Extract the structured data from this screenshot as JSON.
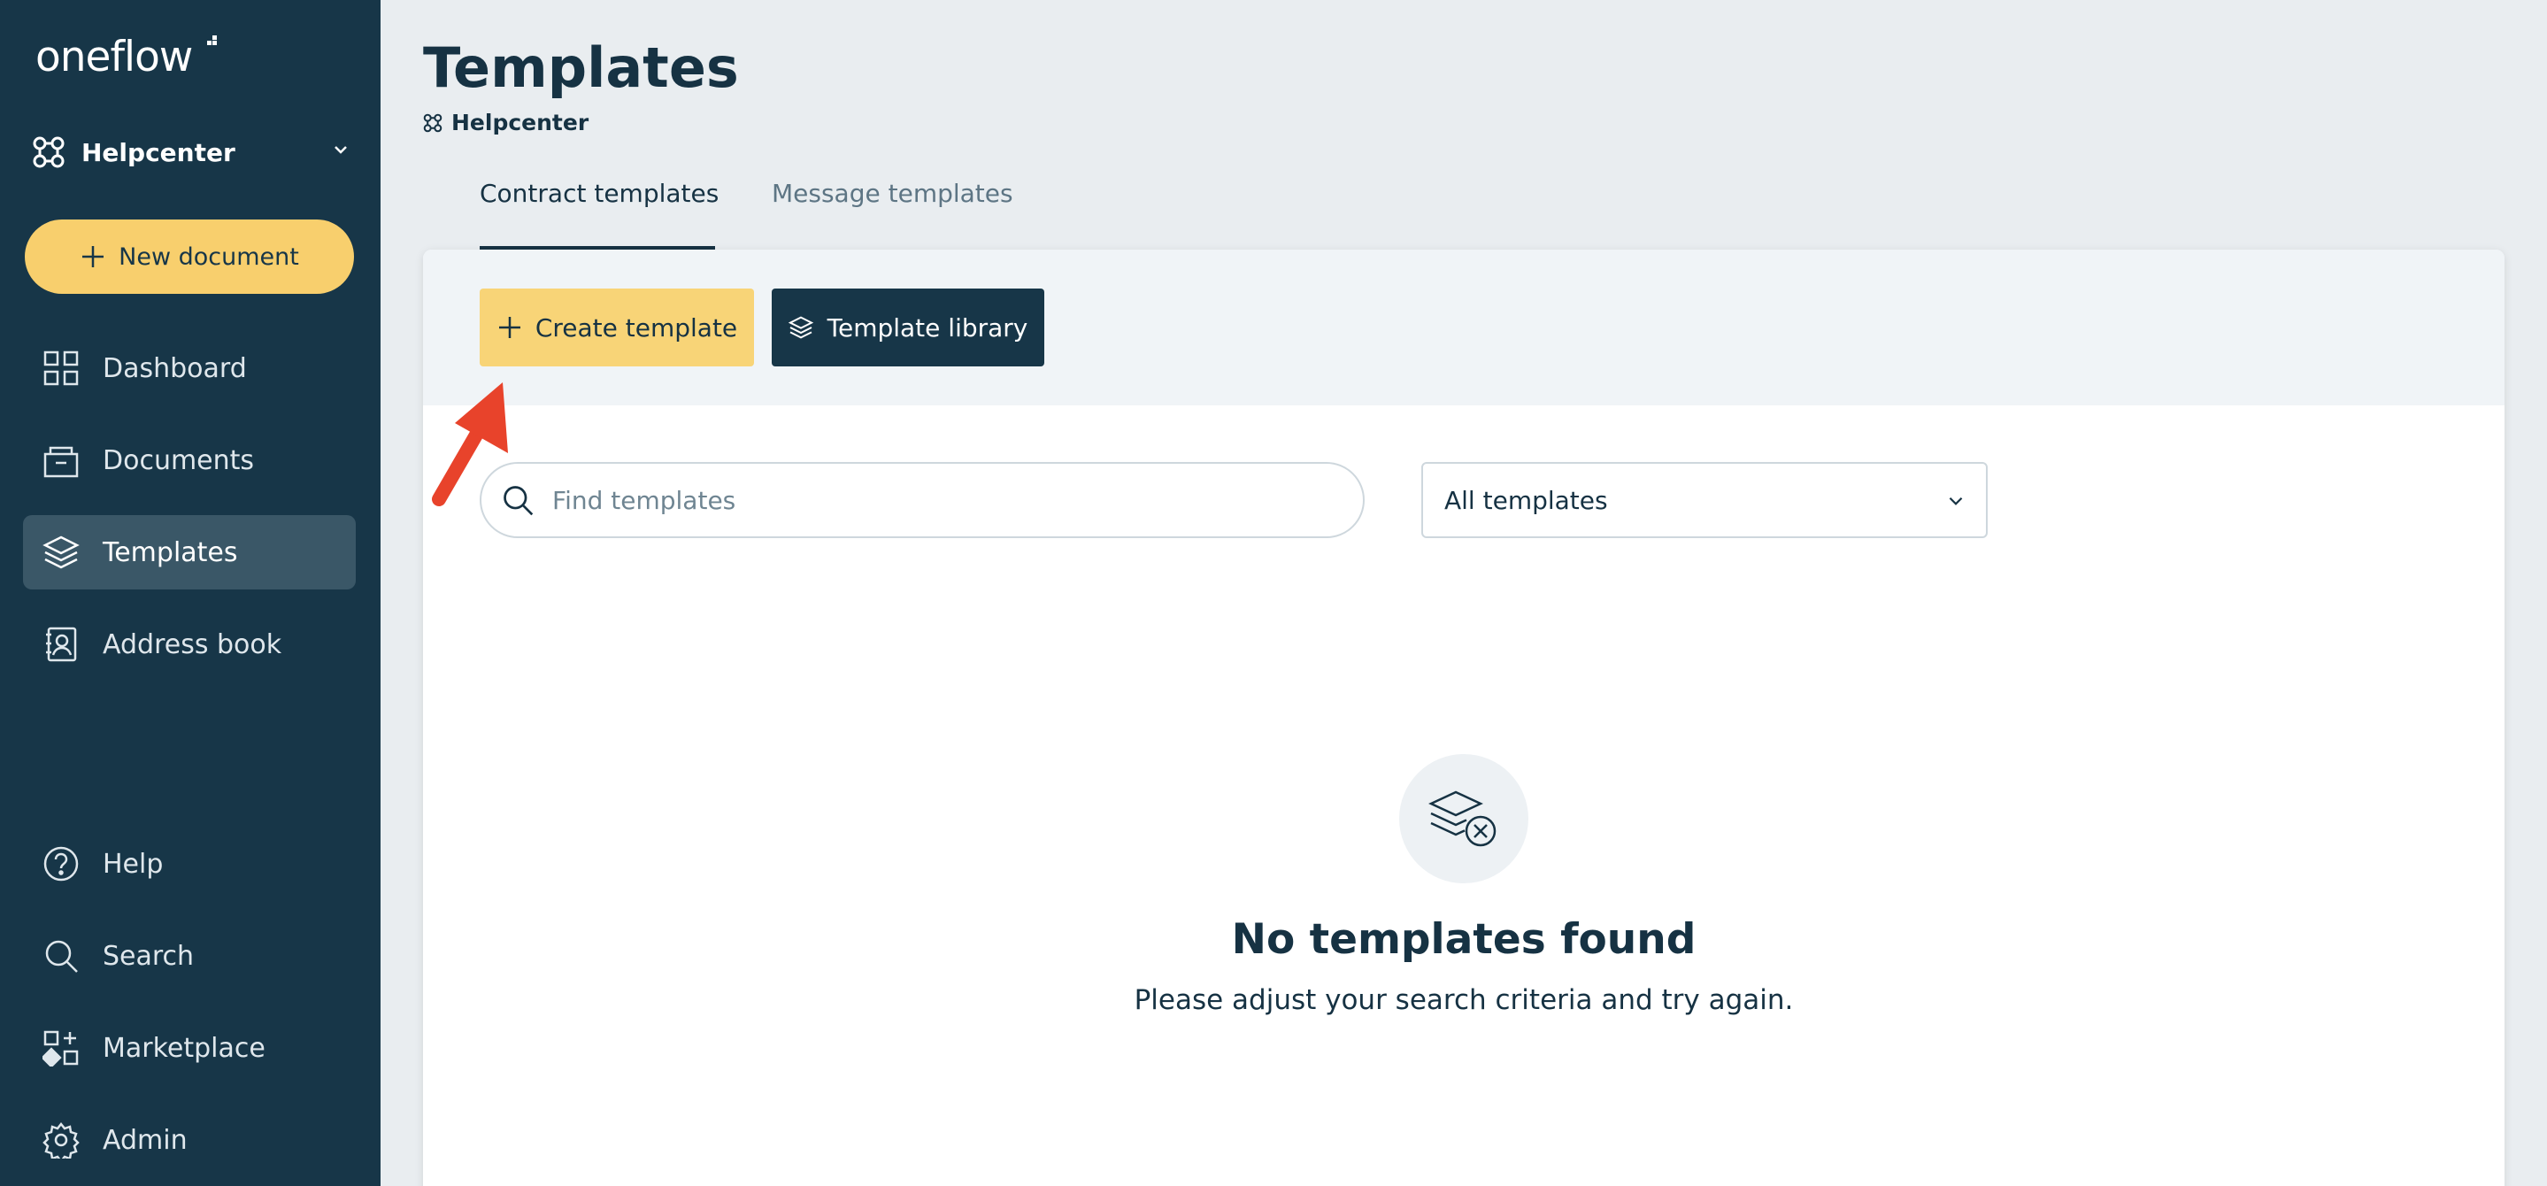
{
  "app": {
    "logo_text": "oneflow"
  },
  "workspace": {
    "name": "Helpcenter"
  },
  "sidebar": {
    "new_document_label": "New document",
    "items": [
      {
        "label": "Dashboard",
        "icon": "dashboard-icon"
      },
      {
        "label": "Documents",
        "icon": "documents-icon"
      },
      {
        "label": "Templates",
        "icon": "templates-icon",
        "active": true
      },
      {
        "label": "Address book",
        "icon": "address-book-icon"
      },
      {
        "label": "Help",
        "icon": "help-icon"
      },
      {
        "label": "Search",
        "icon": "search-icon"
      },
      {
        "label": "Marketplace",
        "icon": "marketplace-icon"
      },
      {
        "label": "Admin",
        "icon": "gear-icon"
      }
    ]
  },
  "header": {
    "title": "Templates",
    "breadcrumb": "Helpcenter",
    "tabs": [
      {
        "label": "Contract templates",
        "active": true
      },
      {
        "label": "Message templates",
        "active": false
      }
    ]
  },
  "toolbar": {
    "create_label": "Create template",
    "library_label": "Template library"
  },
  "filters": {
    "search_placeholder": "Find templates",
    "search_value": "",
    "select_value": "All templates"
  },
  "empty_state": {
    "title": "No templates found",
    "subtitle": "Please adjust your search criteria and try again."
  },
  "colors": {
    "sidebar": "#173648",
    "accent_yellow": "#f8cf6d",
    "annotation_arrow": "#e8432b"
  }
}
